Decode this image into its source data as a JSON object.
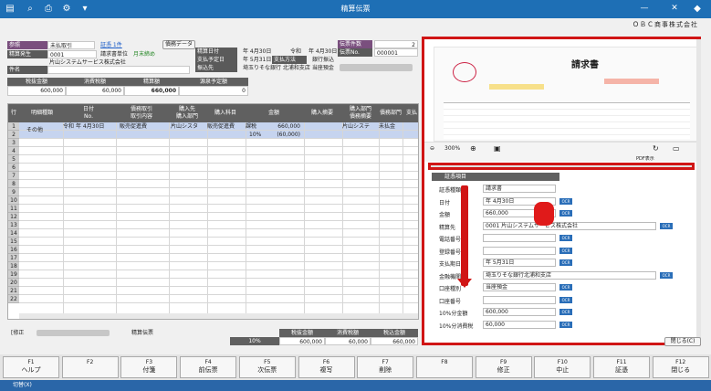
{
  "window": {
    "title": "精算伝票",
    "company": "ＯＢＣ商事株式会社"
  },
  "header": {
    "ref_label": "参照",
    "ref_value": "未払取引",
    "voucher_link": "証憑 1件",
    "voucher_data_btn": "債務データ",
    "dest_label": "精算発生",
    "dest_code": "0001",
    "bill_unit": "請求書単位",
    "month_close": "月末締め",
    "company_name": "片山システムサービス株式会社",
    "subject_label": "件名",
    "date_label": "精算日付",
    "date_value": "年 4月30日",
    "reiwa": "令和",
    "reiwa_date": "年 4月30日",
    "due_label": "支払予定日",
    "due_value": "年 5月31日",
    "method_label": "支払方法",
    "method_value": "銀行振込",
    "bank_label": "振込先",
    "bank_value": "埼玉りそな銀行 北浦和支店 当座預金",
    "count_label": "伝票件数",
    "count_value": "2",
    "no_label": "伝票No.",
    "no_value": "000001"
  },
  "totals": {
    "tax_label": "税抜金額",
    "tax_value": "600,000",
    "ctax_label": "消費税額",
    "ctax_value": "60,000",
    "settle_label": "精算額",
    "settle_value": "660,000",
    "offset_label": "源泉予定額",
    "offset_value": "0"
  },
  "grid": {
    "headers": [
      "行",
      "明細種類",
      "日付",
      "債務取引",
      "購入先",
      "購入科目",
      "金額",
      "購入摘要",
      "購入部門",
      "債務部門",
      "支払"
    ],
    "subheaders": [
      "No.",
      "取引内容",
      "購入部門",
      "",
      "債務摘要"
    ],
    "row1": {
      "num": "1",
      "type": "その他",
      "era": "令和",
      "date": "年 4月30日",
      "content": "販売促進費",
      "vendor": "片山シスタ",
      "dept": "販売促進費",
      "acct": "課税",
      "rate": "10%",
      "amount": "660,000",
      "tax": "(60,000)",
      "dept2": "片山システ",
      "status": "未払金"
    },
    "rows": [
      "1",
      "2",
      "3",
      "4",
      "5",
      "6",
      "7",
      "8",
      "9",
      "10",
      "11",
      "12",
      "13",
      "14",
      "15",
      "16",
      "17",
      "18",
      "19",
      "20",
      "21",
      "22"
    ]
  },
  "footer": {
    "mode": "[修正",
    "slip": "精算伝票",
    "sum_hdr1": "税抜金額",
    "sum_hdr2": "消費税額",
    "sum_hdr3": "税込金額",
    "rate": "10%",
    "sum1": "600,000",
    "sum2": "60,000",
    "sum3": "660,000"
  },
  "preview": {
    "doc_title": "請求書",
    "zoom": "300%",
    "tb_labels": [
      "縮小",
      "全体表示",
      "拡大",
      "全体表示",
      "PDF表示",
      "回転",
      "別画面"
    ],
    "section": "証憑項目",
    "fields": [
      {
        "label": "証憑種類",
        "value": "請求書"
      },
      {
        "label": "日付",
        "value": "年 4月30日"
      },
      {
        "label": "金額",
        "value": "660,000"
      },
      {
        "label": "精算先",
        "value": "0001  片山システムサービス株式会社"
      },
      {
        "label": "電話番号",
        "value": ""
      },
      {
        "label": "登録番号",
        "value": ""
      },
      {
        "label": "支払期日",
        "value": "年 5月31日"
      },
      {
        "label": "金融機関名",
        "value": "埼玉りそな銀行北浦和支店"
      },
      {
        "label": "口座種別",
        "value": "当座預金"
      },
      {
        "label": "口座番号",
        "value": ""
      },
      {
        "label": "10%分金額",
        "value": "600,000"
      },
      {
        "label": "10%分消費税",
        "value": "60,000"
      }
    ],
    "ocr": "OCR",
    "registered": "登録済",
    "tax_excl": "税抜",
    "tax_incl": "税込",
    "close_btn": "閉じる(C)"
  },
  "fkeys": [
    {
      "key": "F1",
      "label": "ヘルプ"
    },
    {
      "key": "F2",
      "label": ""
    },
    {
      "key": "F3",
      "label": "付箋"
    },
    {
      "key": "F4",
      "label": "前伝票"
    },
    {
      "key": "F5",
      "label": "次伝票"
    },
    {
      "key": "F6",
      "label": "複写"
    },
    {
      "key": "F7",
      "label": "削除"
    },
    {
      "key": "F8",
      "label": ""
    },
    {
      "key": "F9",
      "label": "修正"
    },
    {
      "key": "F10",
      "label": "中止"
    },
    {
      "key": "F11",
      "label": "証憑"
    },
    {
      "key": "F12",
      "label": "閉じる"
    }
  ],
  "status": {
    "text": "切替(X)"
  }
}
